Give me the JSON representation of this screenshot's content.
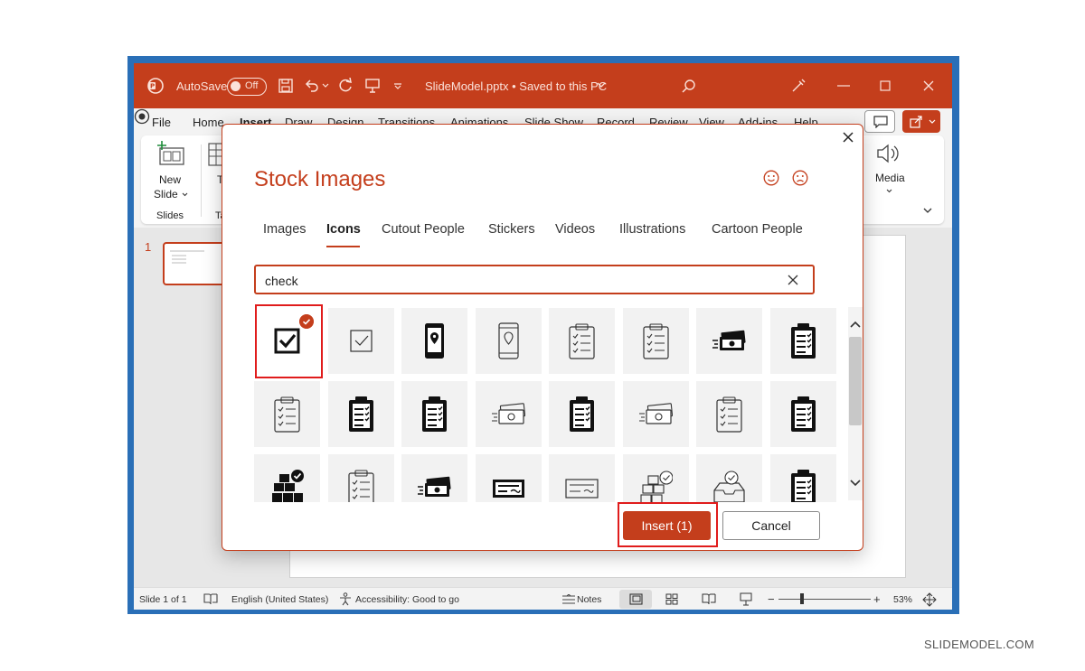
{
  "window": {
    "autosave_label": "AutoSave",
    "autosave_state": "Off",
    "file_status": "SlideModel.pptx • Saved to this PC",
    "colors": {
      "accent": "#c43e1c",
      "titlebar": "#c43e1c",
      "frame": "#2a6fb7"
    }
  },
  "ribbon_tabs": [
    "File",
    "Home",
    "Insert",
    "Draw",
    "Design",
    "Transitions",
    "Animations",
    "Slide Show",
    "Record",
    "Review",
    "View",
    "Add-ins",
    "Help"
  ],
  "ribbon": {
    "new_slide_label": "New",
    "new_slide_label2": "Slide",
    "group_slides": "Slides",
    "table_label": "Ta",
    "group_tables": "Tab",
    "media_label": "Media"
  },
  "thumbnail": {
    "number": "1"
  },
  "status": {
    "slide": "Slide 1 of 1",
    "language": "English (United States)",
    "accessibility": "Accessibility: Good to go",
    "notes": "Notes",
    "zoom_minus": "−",
    "zoom_plus": "+",
    "zoom": "53%"
  },
  "dialog": {
    "title": "Stock Images",
    "tabs": [
      "Images",
      "Icons",
      "Cutout People",
      "Stickers",
      "Videos",
      "Illustrations",
      "Cartoon People"
    ],
    "active_tab": "Icons",
    "search_value": "check",
    "icons": [
      "checkbox-checked-icon",
      "checkbox-thin-icon",
      "phone-location-icon",
      "phone-location-thin-icon",
      "clipboard-checklist-thin-icon",
      "clipboard-checklist-thin-icon",
      "money-stack-icon",
      "clipboard-checklist-icon",
      "clipboard-checklist-thin-icon",
      "clipboard-checklist-icon",
      "clipboard-checklist-icon",
      "money-stack-thin-icon",
      "clipboard-checklist-icon",
      "money-stack-thin-icon",
      "clipboard-checklist-thin-icon",
      "clipboard-checklist-icon",
      "boxes-check-icon",
      "clipboard-checklist-thin-icon",
      "money-stack-icon",
      "bank-check-icon",
      "bank-check-thin-icon",
      "boxes-check-thin-icon",
      "inbox-check-thin-icon",
      "clipboard-checklist-icon"
    ],
    "selected_index": 0,
    "insert_label": "Insert (1)",
    "cancel_label": "Cancel"
  },
  "watermark": "SLIDEMODEL.COM"
}
